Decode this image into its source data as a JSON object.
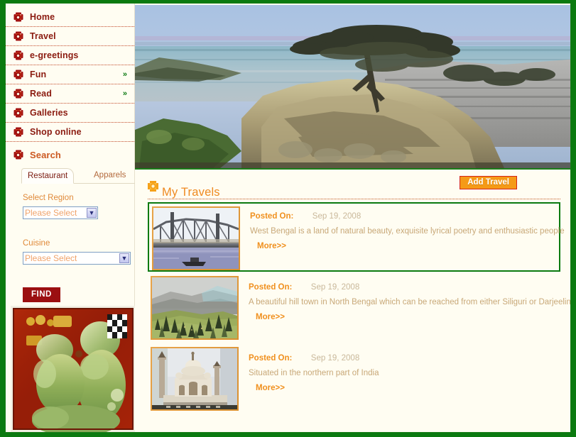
{
  "theme": {
    "frame_green": "#0b7a10",
    "page_bg": "#fffdf2",
    "nav_text": "#8b1b10",
    "accent_orange": "#ef8a22",
    "find_red": "#9b0f11",
    "add_travel_bg": "#f59a17",
    "add_travel_border": "#d4241a"
  },
  "sidebar": {
    "nav_items": [
      {
        "label": "Home",
        "icon": "gear-icon",
        "arrow": ""
      },
      {
        "label": "Travel",
        "icon": "gear-icon",
        "arrow": ""
      },
      {
        "label": "e-greetings",
        "icon": "gear-icon",
        "arrow": ""
      },
      {
        "label": "Fun",
        "icon": "gear-icon",
        "arrow": "»"
      },
      {
        "label": "Read",
        "icon": "gear-icon",
        "arrow": "»"
      },
      {
        "label": "Galleries",
        "icon": "gear-icon",
        "arrow": ""
      },
      {
        "label": "Shop online",
        "icon": "gear-icon",
        "arrow": ""
      }
    ],
    "search": {
      "label": "Search",
      "icon": "gear-icon"
    },
    "tabs": [
      {
        "label": "Restaurant",
        "active": true
      },
      {
        "label": "Apparels",
        "active": false
      }
    ],
    "form": {
      "region_label": "Select Region",
      "region_value": "Please Select",
      "region_options": [
        "Please Select"
      ],
      "cuisine_label": "Cuisine",
      "cuisine_value": "Please Select",
      "cuisine_options": [
        "Please Select"
      ],
      "find_label": "FIND",
      "dropdown_arrow": "▼"
    },
    "artwork_alt": "folk-art-painting"
  },
  "banner": {
    "alt": "lone-cypress-tree-coastal-banner"
  },
  "main": {
    "title": "My Travels",
    "title_icon": "gear-icon",
    "add_travel_label": "Add Travel",
    "posted_on_label": "Posted On:",
    "more_label": "More>>",
    "entries": [
      {
        "thumb_alt": "howrah-bridge-thumbnail",
        "date": "Sep 19, 2008",
        "description": "West Bengal is a land of natural beauty, exquisite lyrical poetry and enthusiastic people",
        "selected": true
      },
      {
        "thumb_alt": "hill-town-valley-thumbnail",
        "date": "Sep 19, 2008",
        "description": "A beautiful hill town in North Bengal which can be reached from either Siliguri or Darjeeling.",
        "selected": false
      },
      {
        "thumb_alt": "taj-mahal-thumbnail",
        "date": "Sep 19, 2008",
        "description": "Situated in the northern part of India",
        "selected": false
      }
    ]
  }
}
